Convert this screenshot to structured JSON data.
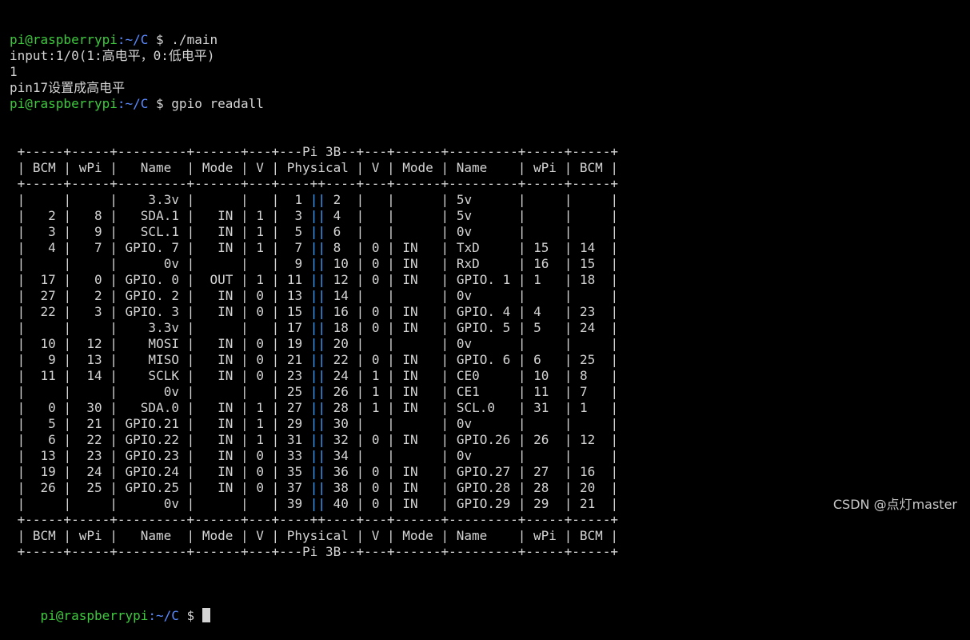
{
  "prompt": {
    "user_host": "pi@raspberrypi",
    "path": ":~/C",
    "symbol": " $ "
  },
  "pre_lines": [
    {
      "kind": "prompt",
      "cmd": "./main"
    },
    {
      "kind": "out",
      "text": "input:1/0(1:高电平，0:低电平)"
    },
    {
      "kind": "out",
      "text": "1"
    },
    {
      "kind": "out",
      "text": "pin17设置成高电平"
    },
    {
      "kind": "prompt",
      "cmd": "gpio readall"
    }
  ],
  "gpio_table": {
    "border_top": " +-----+-----+---------+------+---+---Pi 3B--+---+------+---------+-----+-----+",
    "header": " | BCM | wPi |   Name  | Mode | V | Physical | V | Mode | Name    | wPi | BCM |",
    "separator": " +-----+-----+---------+------+---+----++----+---+------+---------+-----+-----+",
    "rows": [
      [
        "",
        "",
        "3.3v",
        "",
        "",
        "1",
        "2",
        "",
        "",
        "5v",
        "",
        ""
      ],
      [
        "2",
        "8",
        "SDA.1",
        "IN",
        "1",
        "3",
        "4",
        "",
        "",
        "5v",
        "",
        ""
      ],
      [
        "3",
        "9",
        "SCL.1",
        "IN",
        "1",
        "5",
        "6",
        "",
        "",
        "0v",
        "",
        ""
      ],
      [
        "4",
        "7",
        "GPIO. 7",
        "IN",
        "1",
        "7",
        "8",
        "0",
        "IN",
        "TxD",
        "15",
        "14"
      ],
      [
        "",
        "",
        "0v",
        "",
        "",
        "9",
        "10",
        "0",
        "IN",
        "RxD",
        "16",
        "15"
      ],
      [
        "17",
        "0",
        "GPIO. 0",
        "OUT",
        "1",
        "11",
        "12",
        "0",
        "IN",
        "GPIO. 1",
        "1",
        "18"
      ],
      [
        "27",
        "2",
        "GPIO. 2",
        "IN",
        "0",
        "13",
        "14",
        "",
        "",
        "0v",
        "",
        ""
      ],
      [
        "22",
        "3",
        "GPIO. 3",
        "IN",
        "0",
        "15",
        "16",
        "0",
        "IN",
        "GPIO. 4",
        "4",
        "23"
      ],
      [
        "",
        "",
        "3.3v",
        "",
        "",
        "17",
        "18",
        "0",
        "IN",
        "GPIO. 5",
        "5",
        "24"
      ],
      [
        "10",
        "12",
        "MOSI",
        "IN",
        "0",
        "19",
        "20",
        "",
        "",
        "0v",
        "",
        ""
      ],
      [
        "9",
        "13",
        "MISO",
        "IN",
        "0",
        "21",
        "22",
        "0",
        "IN",
        "GPIO. 6",
        "6",
        "25"
      ],
      [
        "11",
        "14",
        "SCLK",
        "IN",
        "0",
        "23",
        "24",
        "1",
        "IN",
        "CE0",
        "10",
        "8"
      ],
      [
        "",
        "",
        "0v",
        "",
        "",
        "25",
        "26",
        "1",
        "IN",
        "CE1",
        "11",
        "7"
      ],
      [
        "0",
        "30",
        "SDA.0",
        "IN",
        "1",
        "27",
        "28",
        "1",
        "IN",
        "SCL.0",
        "31",
        "1"
      ],
      [
        "5",
        "21",
        "GPIO.21",
        "IN",
        "1",
        "29",
        "30",
        "",
        "",
        "0v",
        "",
        ""
      ],
      [
        "6",
        "22",
        "GPIO.22",
        "IN",
        "1",
        "31",
        "32",
        "0",
        "IN",
        "GPIO.26",
        "26",
        "12"
      ],
      [
        "13",
        "23",
        "GPIO.23",
        "IN",
        "0",
        "33",
        "34",
        "",
        "",
        "0v",
        "",
        ""
      ],
      [
        "19",
        "24",
        "GPIO.24",
        "IN",
        "0",
        "35",
        "36",
        "0",
        "IN",
        "GPIO.27",
        "27",
        "16"
      ],
      [
        "26",
        "25",
        "GPIO.25",
        "IN",
        "0",
        "37",
        "38",
        "0",
        "IN",
        "GPIO.28",
        "28",
        "20"
      ],
      [
        "",
        "",
        "0v",
        "",
        "",
        "39",
        "40",
        "0",
        "IN",
        "GPIO.29",
        "29",
        "21"
      ]
    ],
    "separator_bottom": " +-----+-----+---------+------+---+----++----+---+------+---------+-----+-----+",
    "footer": " | BCM | wPi |   Name  | Mode | V | Physical | V | Mode | Name    | wPi | BCM |",
    "border_bottom": " +-----+-----+---------+------+---+---Pi 3B--+---+------+---------+-----+-----+"
  },
  "watermark": "CSDN @点灯master",
  "colors": {
    "background": "#000000",
    "text": "#d4d4d4",
    "prompt_user": "#3ec93e",
    "prompt_path": "#5a8cff",
    "pipe_divider": "#3aa0ff"
  }
}
